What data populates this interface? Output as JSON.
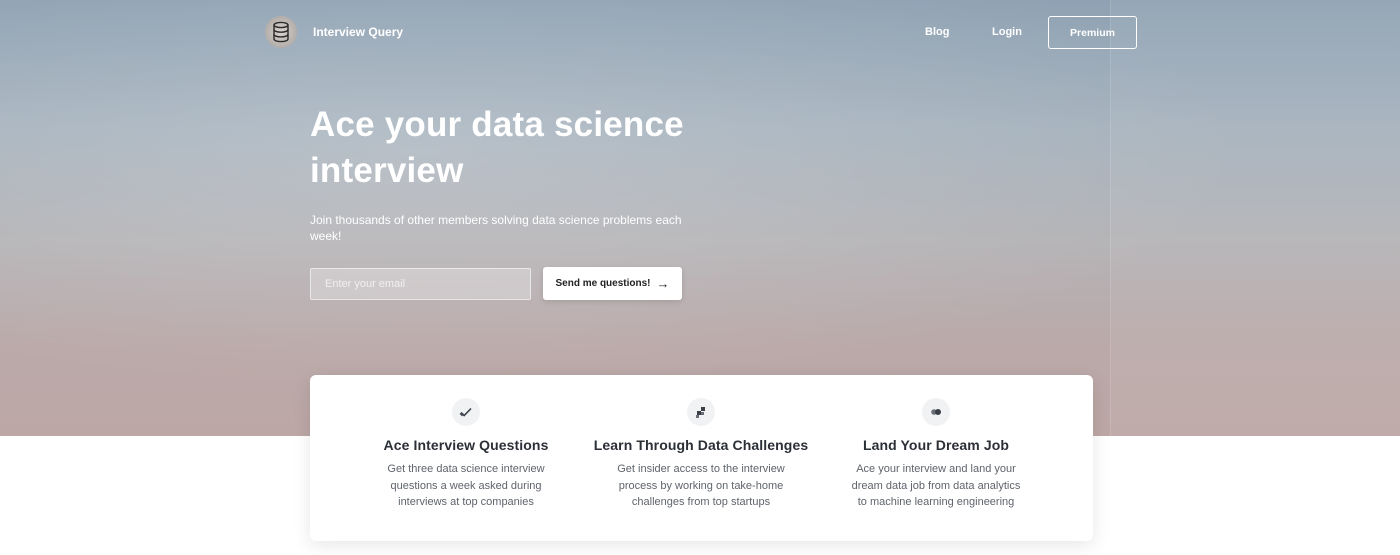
{
  "nav": {
    "brand": "Interview Query",
    "blog": "Blog",
    "login": "Login",
    "premium": "Premium"
  },
  "hero": {
    "title": "Ace your data science interview",
    "subtitle": "Join thousands of other members solving data science problems each week!",
    "email_placeholder": "Enter your email",
    "cta": "Send me questions!"
  },
  "features": [
    {
      "icon": "checkmark-icon",
      "title": "Ace Interview Questions",
      "desc": "Get three data science interview questions a week asked during interviews at top companies"
    },
    {
      "icon": "blocks-icon",
      "title": "Learn Through Data Challenges",
      "desc": "Get insider access to the interview process by working on take-home challenges from top startups"
    },
    {
      "icon": "dots-icon",
      "title": "Land Your Dream Job",
      "desc": "Ace your interview and land your dream data job from data analytics to machine learning engineering"
    }
  ]
}
